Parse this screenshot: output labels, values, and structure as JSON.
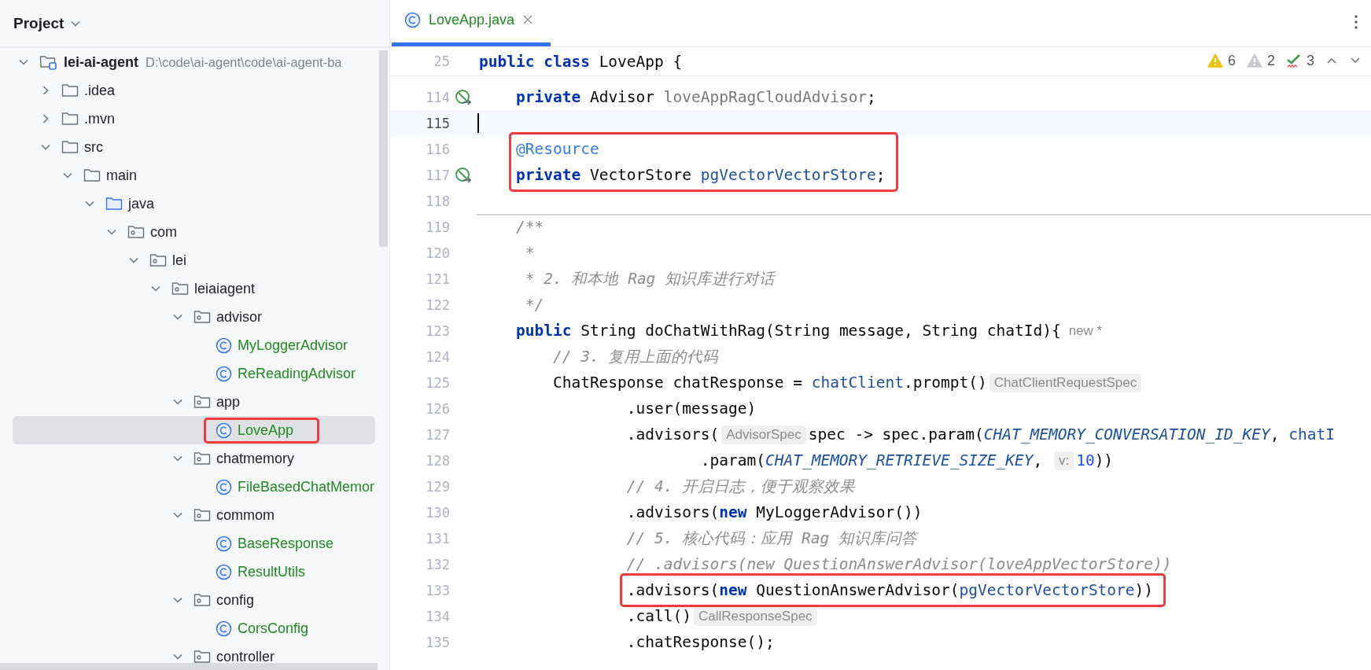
{
  "sidebar": {
    "title": "Project",
    "tree": [
      {
        "kind": "project",
        "name": "lei-ai-agent",
        "path": "D:\\code\\ai-agent\\code\\ai-agent-ba",
        "expanded": true,
        "vcs_added": false,
        "selected": false,
        "highlight": false,
        "children": [
          {
            "kind": "folder",
            "name": ".idea",
            "expanded": false,
            "vcs_added": false,
            "selected": false,
            "highlight": false
          },
          {
            "kind": "folder",
            "name": ".mvn",
            "expanded": false,
            "vcs_added": false,
            "selected": false,
            "highlight": false
          },
          {
            "kind": "folder",
            "name": "src",
            "expanded": true,
            "vcs_added": false,
            "selected": false,
            "highlight": false,
            "children": [
              {
                "kind": "folder",
                "name": "main",
                "expanded": true,
                "vcs_added": false,
                "selected": false,
                "highlight": false,
                "children": [
                  {
                    "kind": "source_root",
                    "name": "java",
                    "expanded": true,
                    "vcs_added": false,
                    "selected": false,
                    "highlight": false,
                    "children": [
                      {
                        "kind": "package",
                        "name": "com",
                        "expanded": true,
                        "vcs_added": false,
                        "selected": false,
                        "highlight": false,
                        "children": [
                          {
                            "kind": "package",
                            "name": "lei",
                            "expanded": true,
                            "vcs_added": false,
                            "selected": false,
                            "highlight": false,
                            "children": [
                              {
                                "kind": "package",
                                "name": "leiaiagent",
                                "expanded": true,
                                "vcs_added": false,
                                "selected": false,
                                "highlight": false,
                                "children": [
                                  {
                                    "kind": "package",
                                    "name": "advisor",
                                    "expanded": true,
                                    "vcs_added": false,
                                    "selected": false,
                                    "highlight": false,
                                    "children": [
                                      {
                                        "kind": "class",
                                        "name": "MyLoggerAdvisor",
                                        "vcs_added": true,
                                        "selected": false,
                                        "highlight": false
                                      },
                                      {
                                        "kind": "class",
                                        "name": "ReReadingAdvisor",
                                        "vcs_added": true,
                                        "selected": false,
                                        "highlight": false
                                      }
                                    ]
                                  },
                                  {
                                    "kind": "package",
                                    "name": "app",
                                    "expanded": true,
                                    "vcs_added": false,
                                    "selected": false,
                                    "highlight": false,
                                    "children": [
                                      {
                                        "kind": "class",
                                        "name": "LoveApp",
                                        "vcs_added": true,
                                        "selected": true,
                                        "highlight": true
                                      }
                                    ]
                                  },
                                  {
                                    "kind": "package",
                                    "name": "chatmemory",
                                    "expanded": true,
                                    "vcs_added": false,
                                    "selected": false,
                                    "highlight": false,
                                    "children": [
                                      {
                                        "kind": "class",
                                        "name": "FileBasedChatMemor",
                                        "vcs_added": true,
                                        "selected": false,
                                        "highlight": false
                                      }
                                    ]
                                  },
                                  {
                                    "kind": "package",
                                    "name": "commom",
                                    "expanded": true,
                                    "vcs_added": false,
                                    "selected": false,
                                    "highlight": false,
                                    "children": [
                                      {
                                        "kind": "class",
                                        "name": "BaseResponse",
                                        "vcs_added": true,
                                        "selected": false,
                                        "highlight": false
                                      },
                                      {
                                        "kind": "class",
                                        "name": "ResultUtils",
                                        "vcs_added": true,
                                        "selected": false,
                                        "highlight": false
                                      }
                                    ]
                                  },
                                  {
                                    "kind": "package",
                                    "name": "config",
                                    "expanded": true,
                                    "vcs_added": false,
                                    "selected": false,
                                    "highlight": false,
                                    "children": [
                                      {
                                        "kind": "class",
                                        "name": "CorsConfig",
                                        "vcs_added": true,
                                        "selected": false,
                                        "highlight": false
                                      }
                                    ]
                                  },
                                  {
                                    "kind": "package",
                                    "name": "controller",
                                    "expanded": true,
                                    "vcs_added": false,
                                    "selected": false,
                                    "highlight": false
                                  }
                                ]
                              }
                            ]
                          }
                        ]
                      }
                    ]
                  }
                ]
              }
            ]
          }
        ]
      }
    ]
  },
  "editor": {
    "tabs": [
      {
        "label": "LoveApp.java",
        "vcs_added": true,
        "selected": true
      }
    ],
    "inspections": [
      {
        "kind": "warning",
        "count": "6"
      },
      {
        "kind": "weak_warning",
        "count": "2"
      },
      {
        "kind": "typo",
        "count": "3"
      }
    ],
    "sticky_line": {
      "number": "25",
      "tokens": [
        {
          "kind": "keyword",
          "text": "public class"
        },
        {
          "kind": "text",
          "text": " LoveApp {"
        }
      ]
    },
    "lines": [
      {
        "number": "114",
        "current": false,
        "highlight": false,
        "gutter_icon": true,
        "separator_above": false,
        "tokens": [
          {
            "kind": "keyword",
            "text": "    private"
          },
          {
            "kind": "text",
            "text": " Advisor "
          },
          {
            "kind": "unused",
            "text": "loveAppRagCloudAdvisor"
          },
          {
            "kind": "text",
            "text": ";"
          }
        ]
      },
      {
        "number": "115",
        "current": true,
        "highlight": false,
        "gutter_icon": false,
        "separator_above": false
      },
      {
        "number": "116",
        "current": false,
        "highlight": true,
        "gutter_icon": false,
        "separator_above": false,
        "tokens": [
          {
            "kind": "annotation",
            "text": "    @Resource"
          }
        ]
      },
      {
        "number": "117",
        "current": false,
        "highlight": true,
        "gutter_icon": true,
        "separator_above": false,
        "tokens": [
          {
            "kind": "keyword",
            "text": "    private"
          },
          {
            "kind": "text",
            "text": " VectorStore "
          },
          {
            "kind": "field",
            "text": "pgVectorVectorStore"
          },
          {
            "kind": "text",
            "text": ";"
          }
        ]
      },
      {
        "number": "118",
        "current": false,
        "highlight": false,
        "gutter_icon": false,
        "separator_above": false
      },
      {
        "number": "119",
        "current": false,
        "highlight": false,
        "gutter_icon": false,
        "separator_above": true,
        "tokens": [
          {
            "kind": "comment",
            "text": "    /**"
          }
        ]
      },
      {
        "number": "120",
        "current": false,
        "highlight": false,
        "gutter_icon": false,
        "separator_above": false,
        "tokens": [
          {
            "kind": "comment",
            "text": "     *"
          }
        ]
      },
      {
        "number": "121",
        "current": false,
        "highlight": false,
        "gutter_icon": false,
        "separator_above": false,
        "tokens": [
          {
            "kind": "comment",
            "text": "     * 2. 和本地 Rag 知识库进行对话"
          }
        ]
      },
      {
        "number": "122",
        "current": false,
        "highlight": false,
        "gutter_icon": false,
        "separator_above": false,
        "tokens": [
          {
            "kind": "comment",
            "text": "     */"
          }
        ]
      },
      {
        "number": "123",
        "current": false,
        "highlight": false,
        "gutter_icon": false,
        "separator_above": false,
        "tokens": [
          {
            "kind": "keyword",
            "text": "    public"
          },
          {
            "kind": "text",
            "text": " String doChatWithRag(String message, String chatId){"
          },
          {
            "kind": "note",
            "text": "new *"
          }
        ]
      },
      {
        "number": "124",
        "current": false,
        "highlight": false,
        "gutter_icon": false,
        "separator_above": false,
        "tokens": [
          {
            "kind": "comment",
            "text": "        // 3. 复用上面的代码"
          }
        ]
      },
      {
        "number": "125",
        "current": false,
        "highlight": false,
        "gutter_icon": false,
        "separator_above": false,
        "tokens": [
          {
            "kind": "text",
            "text": "        ChatResponse chatResponse = "
          },
          {
            "kind": "field",
            "text": "chatClient"
          },
          {
            "kind": "text",
            "text": ".prompt()"
          },
          {
            "kind": "hint",
            "text": "ChatClientRequestSpec"
          }
        ]
      },
      {
        "number": "126",
        "current": false,
        "highlight": false,
        "gutter_icon": false,
        "separator_above": false,
        "tokens": [
          {
            "kind": "text",
            "text": "                .user(message)"
          }
        ]
      },
      {
        "number": "127",
        "current": false,
        "highlight": false,
        "gutter_icon": false,
        "separator_above": false,
        "tokens": [
          {
            "kind": "text",
            "text": "                .advisors("
          },
          {
            "kind": "hint",
            "text": "AdvisorSpec"
          },
          {
            "kind": "text",
            "text": "spec -> spec.param("
          },
          {
            "kind": "constant",
            "text": "CHAT_MEMORY_CONVERSATION_ID_KEY"
          },
          {
            "kind": "text",
            "text": ", "
          },
          {
            "kind": "field",
            "text": "chatI"
          }
        ]
      },
      {
        "number": "128",
        "current": false,
        "highlight": false,
        "gutter_icon": false,
        "separator_above": false,
        "tokens": [
          {
            "kind": "text",
            "text": "                        .param("
          },
          {
            "kind": "constant",
            "text": "CHAT_MEMORY_RETRIEVE_SIZE_KEY"
          },
          {
            "kind": "text",
            "text": ", "
          },
          {
            "kind": "hint",
            "text": "v:"
          },
          {
            "kind": "number",
            "text": "10"
          },
          {
            "kind": "text",
            "text": "))"
          }
        ]
      },
      {
        "number": "129",
        "current": false,
        "highlight": false,
        "gutter_icon": false,
        "separator_above": false,
        "tokens": [
          {
            "kind": "comment",
            "text": "                // 4. 开启日志，便于观察效果"
          }
        ]
      },
      {
        "number": "130",
        "current": false,
        "highlight": false,
        "gutter_icon": false,
        "separator_above": false,
        "tokens": [
          {
            "kind": "text",
            "text": "                .advisors("
          },
          {
            "kind": "keyword",
            "text": "new"
          },
          {
            "kind": "text",
            "text": " MyLoggerAdvisor())"
          }
        ]
      },
      {
        "number": "131",
        "current": false,
        "highlight": false,
        "gutter_icon": false,
        "separator_above": false,
        "tokens": [
          {
            "kind": "comment",
            "text": "                // 5. 核心代码：应用 Rag 知识库问答"
          }
        ]
      },
      {
        "number": "132",
        "current": false,
        "highlight": false,
        "gutter_icon": false,
        "separator_above": false,
        "tokens": [
          {
            "kind": "comment",
            "text": "                // .advisors(new QuestionAnswerAdvisor(loveAppVectorStore))"
          }
        ]
      },
      {
        "number": "133",
        "current": false,
        "highlight": true,
        "gutter_icon": false,
        "separator_above": false,
        "tokens": [
          {
            "kind": "text",
            "text": "                .advisors("
          },
          {
            "kind": "keyword",
            "text": "new"
          },
          {
            "kind": "text",
            "text": " QuestionAnswerAdvisor("
          },
          {
            "kind": "field",
            "text": "pgVectorVectorStore"
          },
          {
            "kind": "text",
            "text": "))"
          }
        ]
      },
      {
        "number": "134",
        "current": false,
        "highlight": false,
        "gutter_icon": false,
        "separator_above": false,
        "tokens": [
          {
            "kind": "text",
            "text": "                .call()"
          },
          {
            "kind": "hint",
            "text": "CallResponseSpec"
          }
        ]
      },
      {
        "number": "135",
        "current": false,
        "highlight": false,
        "gutter_icon": false,
        "separator_above": false,
        "tokens": [
          {
            "kind": "text",
            "text": "                .chatResponse();"
          }
        ]
      }
    ]
  }
}
